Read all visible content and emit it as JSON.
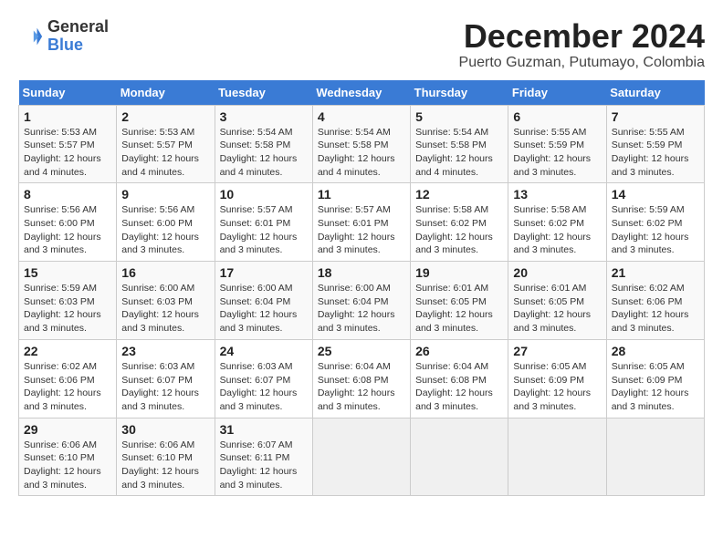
{
  "logo": {
    "line1": "General",
    "line2": "Blue"
  },
  "title": "December 2024",
  "subtitle": "Puerto Guzman, Putumayo, Colombia",
  "weekdays": [
    "Sunday",
    "Monday",
    "Tuesday",
    "Wednesday",
    "Thursday",
    "Friday",
    "Saturday"
  ],
  "weeks": [
    [
      {
        "day": "1",
        "info": "Sunrise: 5:53 AM\nSunset: 5:57 PM\nDaylight: 12 hours\nand 4 minutes."
      },
      {
        "day": "2",
        "info": "Sunrise: 5:53 AM\nSunset: 5:57 PM\nDaylight: 12 hours\nand 4 minutes."
      },
      {
        "day": "3",
        "info": "Sunrise: 5:54 AM\nSunset: 5:58 PM\nDaylight: 12 hours\nand 4 minutes."
      },
      {
        "day": "4",
        "info": "Sunrise: 5:54 AM\nSunset: 5:58 PM\nDaylight: 12 hours\nand 4 minutes."
      },
      {
        "day": "5",
        "info": "Sunrise: 5:54 AM\nSunset: 5:58 PM\nDaylight: 12 hours\nand 4 minutes."
      },
      {
        "day": "6",
        "info": "Sunrise: 5:55 AM\nSunset: 5:59 PM\nDaylight: 12 hours\nand 3 minutes."
      },
      {
        "day": "7",
        "info": "Sunrise: 5:55 AM\nSunset: 5:59 PM\nDaylight: 12 hours\nand 3 minutes."
      }
    ],
    [
      {
        "day": "8",
        "info": "Sunrise: 5:56 AM\nSunset: 6:00 PM\nDaylight: 12 hours\nand 3 minutes."
      },
      {
        "day": "9",
        "info": "Sunrise: 5:56 AM\nSunset: 6:00 PM\nDaylight: 12 hours\nand 3 minutes."
      },
      {
        "day": "10",
        "info": "Sunrise: 5:57 AM\nSunset: 6:01 PM\nDaylight: 12 hours\nand 3 minutes."
      },
      {
        "day": "11",
        "info": "Sunrise: 5:57 AM\nSunset: 6:01 PM\nDaylight: 12 hours\nand 3 minutes."
      },
      {
        "day": "12",
        "info": "Sunrise: 5:58 AM\nSunset: 6:02 PM\nDaylight: 12 hours\nand 3 minutes."
      },
      {
        "day": "13",
        "info": "Sunrise: 5:58 AM\nSunset: 6:02 PM\nDaylight: 12 hours\nand 3 minutes."
      },
      {
        "day": "14",
        "info": "Sunrise: 5:59 AM\nSunset: 6:02 PM\nDaylight: 12 hours\nand 3 minutes."
      }
    ],
    [
      {
        "day": "15",
        "info": "Sunrise: 5:59 AM\nSunset: 6:03 PM\nDaylight: 12 hours\nand 3 minutes."
      },
      {
        "day": "16",
        "info": "Sunrise: 6:00 AM\nSunset: 6:03 PM\nDaylight: 12 hours\nand 3 minutes."
      },
      {
        "day": "17",
        "info": "Sunrise: 6:00 AM\nSunset: 6:04 PM\nDaylight: 12 hours\nand 3 minutes."
      },
      {
        "day": "18",
        "info": "Sunrise: 6:00 AM\nSunset: 6:04 PM\nDaylight: 12 hours\nand 3 minutes."
      },
      {
        "day": "19",
        "info": "Sunrise: 6:01 AM\nSunset: 6:05 PM\nDaylight: 12 hours\nand 3 minutes."
      },
      {
        "day": "20",
        "info": "Sunrise: 6:01 AM\nSunset: 6:05 PM\nDaylight: 12 hours\nand 3 minutes."
      },
      {
        "day": "21",
        "info": "Sunrise: 6:02 AM\nSunset: 6:06 PM\nDaylight: 12 hours\nand 3 minutes."
      }
    ],
    [
      {
        "day": "22",
        "info": "Sunrise: 6:02 AM\nSunset: 6:06 PM\nDaylight: 12 hours\nand 3 minutes."
      },
      {
        "day": "23",
        "info": "Sunrise: 6:03 AM\nSunset: 6:07 PM\nDaylight: 12 hours\nand 3 minutes."
      },
      {
        "day": "24",
        "info": "Sunrise: 6:03 AM\nSunset: 6:07 PM\nDaylight: 12 hours\nand 3 minutes."
      },
      {
        "day": "25",
        "info": "Sunrise: 6:04 AM\nSunset: 6:08 PM\nDaylight: 12 hours\nand 3 minutes."
      },
      {
        "day": "26",
        "info": "Sunrise: 6:04 AM\nSunset: 6:08 PM\nDaylight: 12 hours\nand 3 minutes."
      },
      {
        "day": "27",
        "info": "Sunrise: 6:05 AM\nSunset: 6:09 PM\nDaylight: 12 hours\nand 3 minutes."
      },
      {
        "day": "28",
        "info": "Sunrise: 6:05 AM\nSunset: 6:09 PM\nDaylight: 12 hours\nand 3 minutes."
      }
    ],
    [
      {
        "day": "29",
        "info": "Sunrise: 6:06 AM\nSunset: 6:10 PM\nDaylight: 12 hours\nand 3 minutes."
      },
      {
        "day": "30",
        "info": "Sunrise: 6:06 AM\nSunset: 6:10 PM\nDaylight: 12 hours\nand 3 minutes."
      },
      {
        "day": "31",
        "info": "Sunrise: 6:07 AM\nSunset: 6:11 PM\nDaylight: 12 hours\nand 3 minutes."
      },
      null,
      null,
      null,
      null
    ]
  ]
}
